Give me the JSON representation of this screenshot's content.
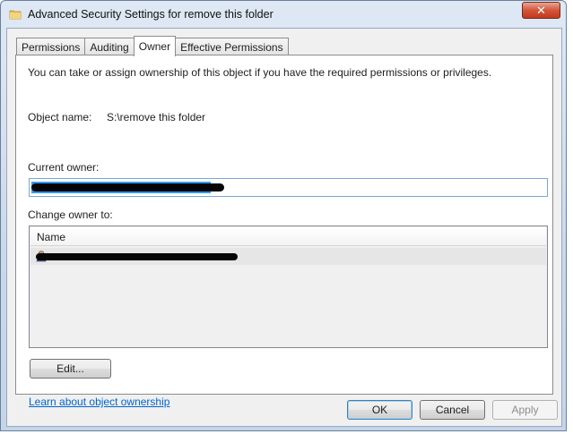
{
  "window": {
    "title": "Advanced Security Settings for remove this folder",
    "close_label": "✕"
  },
  "tabs": [
    {
      "label": "Permissions",
      "active": false
    },
    {
      "label": "Auditing",
      "active": false
    },
    {
      "label": "Owner",
      "active": true
    },
    {
      "label": "Effective Permissions",
      "active": false
    }
  ],
  "owner": {
    "intro": "You can take or assign ownership of this object if you have the required permissions or privileges.",
    "object_name_label": "Object name:",
    "object_name_value": "S:\\remove this folder",
    "current_owner_label": "Current owner:",
    "change_owner_label": "Change owner to:",
    "list_header": "Name",
    "edit_button": "Edit...",
    "learn_link": "Learn about object ownership"
  },
  "buttons": {
    "ok": "OK",
    "cancel": "Cancel",
    "apply": "Apply"
  }
}
